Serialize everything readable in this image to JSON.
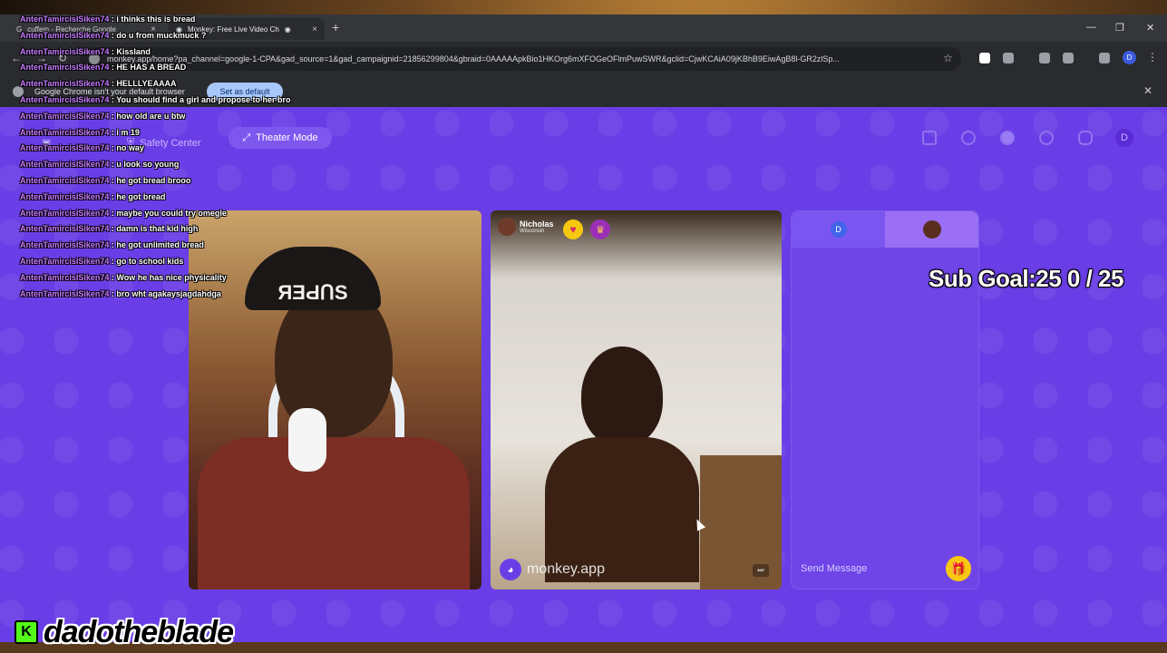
{
  "browser": {
    "tabs": [
      {
        "label": "cuffem - Recherche Google"
      },
      {
        "label": "Monkey: Free Live Video Ch"
      }
    ],
    "new_tab": "+",
    "url": "monkey.app/home?pa_channel=google-1-CPA&gad_source=1&gad_campaignid=21856299804&gbraid=0AAAAApkBio1HKOrg6mXFOGeOFlmPuwSWR&gclid=CjwKCAiA09jKBhB9EiwAgB8l-GR2zlSp...",
    "infobar": {
      "message": "Google Chrome isn't your default browser",
      "button": "Set as default"
    },
    "profile_initial": "D"
  },
  "app": {
    "header": {
      "safety_center": "Safety Center",
      "theater_mode": "Theater Mode",
      "avatar_initial": "D"
    },
    "remote_user": {
      "name": "Nicholas",
      "location": "Wisconsin"
    },
    "watermark": "monkey.app",
    "chat": {
      "tab_initial": "D",
      "send_placeholder": "Send Message"
    }
  },
  "stream_overlay": {
    "sub_goal": "Sub Goal:25  0 / 25",
    "streamer": "dadotheblade",
    "chat": [
      {
        "user": "AntenTamircisISiken74",
        "text": ": i thinks this is bread"
      },
      {
        "user": "AntenTamircisISiken74",
        "text": ": do u from muckmuck ?"
      },
      {
        "user": "AntenTamircisISiken74",
        "text": ": Kissland"
      },
      {
        "user": "AntenTamircisISiken74",
        "text": ": HE HAS A BREAD"
      },
      {
        "user": "AntenTamircisISiken74",
        "text": ": HELLLYEAAAA"
      },
      {
        "user": "AntenTamircisISiken74",
        "text": ": You should find a girl and propose to her bro"
      },
      {
        "user": "AntenTamircisISiken74",
        "text": ": how old are u btw"
      },
      {
        "user": "AntenTamircisISiken74",
        "text": ": i m 19"
      },
      {
        "user": "AntenTamircisISiken74",
        "text": ": no way"
      },
      {
        "user": "AntenTamircisISiken74",
        "text": ": u look so young"
      },
      {
        "user": "AntenTamircisISiken74",
        "text": ": he got bread brooo"
      },
      {
        "user": "AntenTamircisISiken74",
        "text": ": he got bread"
      },
      {
        "user": "AntenTamircisISiken74",
        "text": ": maybe you could try omegle"
      },
      {
        "user": "AntenTamircisISiken74",
        "text": ": damn is that kid high"
      },
      {
        "user": "AntenTamircisISiken74",
        "text": ": he got unlimited bread"
      },
      {
        "user": "AntenTamircisISiken74",
        "text": ": go to school kids"
      },
      {
        "user": "AntenTamircisISiken74",
        "text": ": Wow he has nice physicality"
      },
      {
        "user": "AntenTamircisISiken74",
        "text": ": bro wht agakaysjagdahdga"
      }
    ]
  }
}
